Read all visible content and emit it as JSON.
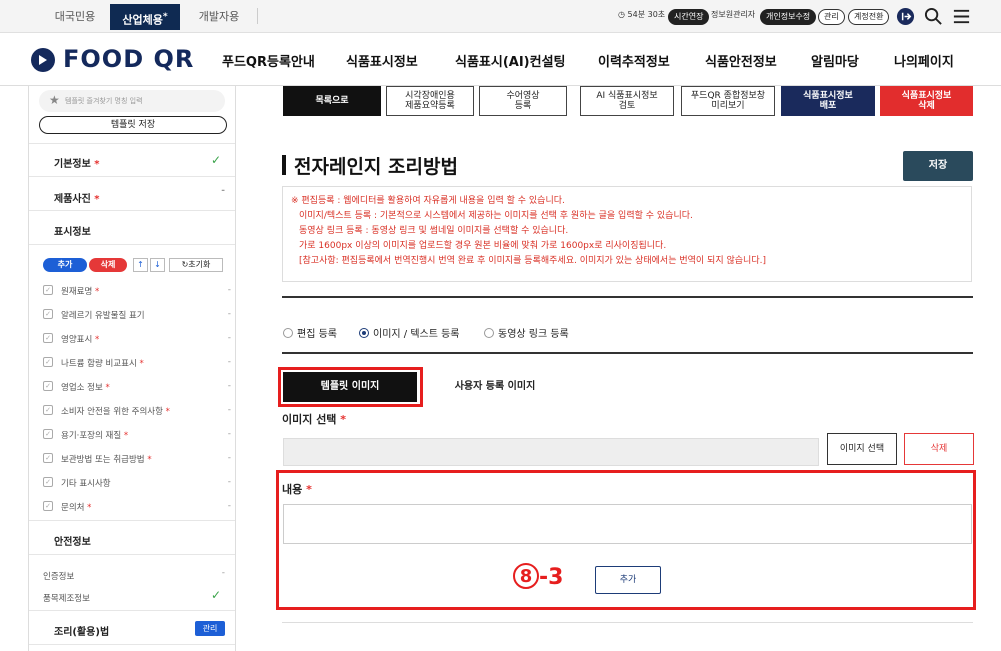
{
  "topbar": {
    "tabs": [
      "대국민용",
      "산업체용",
      "개발자용"
    ],
    "active_tab_mark": "*",
    "timer": "54분 30초",
    "extend": "시간연장",
    "admin_user": "정보원관리자",
    "edit_info": "개인정보수정",
    "manage": "관리",
    "switch_account": "계정전환"
  },
  "nav": {
    "logo": "FOOD QR",
    "items": [
      "푸드QR등록안내",
      "식품표시정보",
      "식품표시(AI)컨설팅",
      "이력추적정보",
      "식품안전정보",
      "알림마당",
      "나의페이지"
    ]
  },
  "sidebar": {
    "fav_placeholder": "템플릿 즐겨찾기 명칭 입력",
    "template_save": "템플릿 저장",
    "basic_info": "기본정보",
    "product_photo": "제품사진",
    "label_info": "표시정보",
    "add": "추가",
    "delete": "삭제",
    "up": "↑",
    "down": "↓",
    "reset": "초기화",
    "items": [
      "원재료명",
      "알레르기 유발물질 표기",
      "영양표시",
      "나트륨 함량 비교표시",
      "영업소 정보",
      "소비자 안전을 위한 주의사항",
      "용기·포장의 재질",
      "보관방법 또는 취급방법",
      "기타 표시사항",
      "문의처"
    ],
    "items_required": [
      true,
      false,
      true,
      true,
      true,
      true,
      true,
      true,
      false,
      true
    ],
    "safety_info": "안전정보",
    "certification": "인증정보",
    "product_report": "품목제조정보",
    "cooking": "조리(활용)법",
    "manage": "관리"
  },
  "toolbar": {
    "list": "목록으로",
    "accessible_summary_1": "시각장애인용",
    "accessible_summary_2": "제품요약등록",
    "sign_video_1": "수어영상",
    "sign_video_2": "등록",
    "ai_review_1": "AI 식품표시정보",
    "ai_review_2": "검토",
    "preview_1": "푸드QR 종합정보창",
    "preview_2": "미리보기",
    "deploy_1": "식품표시정보",
    "deploy_2": "배포",
    "delete_1": "식품표시정보",
    "delete_2": "삭제"
  },
  "main": {
    "title": "전자레인지 조리방법",
    "save": "저장",
    "notice": [
      "※ 편집등록 : 웹에디터를 활용하여 자유롭게 내용을 입력 할 수 있습니다.",
      "이미지/텍스트 등록 : 기본적으로 시스템에서 제공하는 이미지를 선택 후 원하는 글을 입력할 수 있습니다.",
      "동영상 링크 등록 : 동영상 링크 및 썸네일 이미지를 선택할 수 있습니다.",
      "가로 1600px 이상의 이미지를 업로드할 경우 원본 비율에 맞춰 가로 1600px로 리사이징됩니다.",
      "[참고사항: 편집등록에서 번역진행시 번역 완료 후 이미지를 등록해주세요. 이미지가 있는 상태에서는 번역이 되지 않습니다.]"
    ],
    "radio_options": [
      "편집 등록",
      "이미지 / 텍스트 등록",
      "동영상 링크 등록"
    ],
    "radio_selected": 1,
    "tab_template": "템플릿 이미지",
    "tab_user": "사용자 등록 이미지",
    "image_select_label": "이미지 선택",
    "image_select_btn": "이미지 선택",
    "image_delete_btn": "삭제",
    "content_label": "내용",
    "step_circle": "8",
    "step_suffix": "-3",
    "add_btn": "추가"
  }
}
